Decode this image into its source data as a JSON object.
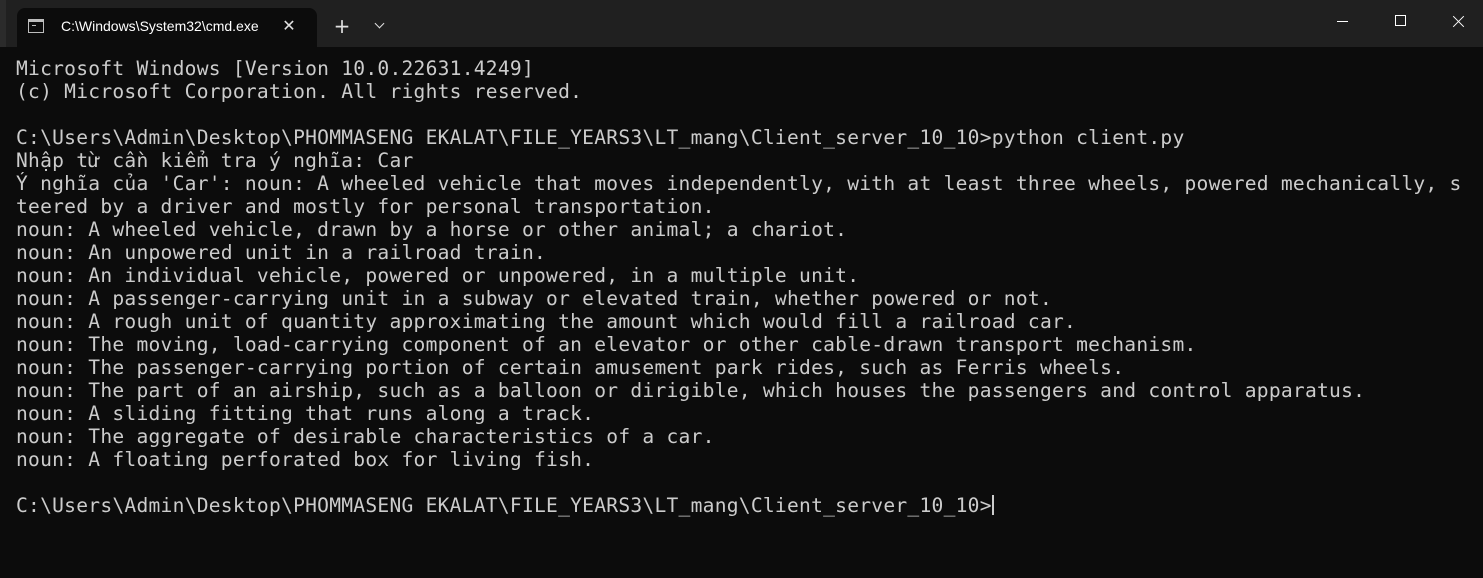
{
  "tab": {
    "title": "C:\\Windows\\System32\\cmd.exe",
    "icon": "cmd-icon",
    "close_icon": "close-icon"
  },
  "toolbar": {
    "new_tab_label": "+",
    "dropdown_icon": "chevron-down-icon"
  },
  "window_controls": [
    "minimize-icon",
    "maximize-icon",
    "close-icon"
  ],
  "console": {
    "lines": [
      "Microsoft Windows [Version 10.0.22631.4249]",
      "(c) Microsoft Corporation. All rights reserved.",
      "",
      "C:\\Users\\Admin\\Desktop\\PHOMMASENG EKALAT\\FILE_YEARS3\\LT_mang\\Client_server_10_10>python client.py",
      "Nhập từ cần kiểm tra ý nghĩa: Car",
      "Ý nghĩa của 'Car': noun: A wheeled vehicle that moves independently, with at least three wheels, powered mechanically, s",
      "teered by a driver and mostly for personal transportation.",
      "noun: A wheeled vehicle, drawn by a horse or other animal; a chariot.",
      "noun: An unpowered unit in a railroad train.",
      "noun: An individual vehicle, powered or unpowered, in a multiple unit.",
      "noun: A passenger-carrying unit in a subway or elevated train, whether powered or not.",
      "noun: A rough unit of quantity approximating the amount which would fill a railroad car.",
      "noun: The moving, load-carrying component of an elevator or other cable-drawn transport mechanism.",
      "noun: The passenger-carrying portion of certain amusement park rides, such as Ferris wheels.",
      "noun: The part of an airship, such as a balloon or dirigible, which houses the passengers and control apparatus.",
      "noun: A sliding fitting that runs along a track.",
      "noun: The aggregate of desirable characteristics of a car.",
      "noun: A floating perforated box for living fish.",
      ""
    ],
    "prompt": "C:\\Users\\Admin\\Desktop\\PHOMMASENG EKALAT\\FILE_YEARS3\\LT_mang\\Client_server_10_10>"
  },
  "colors": {
    "titlebar_bg": "#202020",
    "console_bg": "#0c0c0c",
    "console_text": "#cccccc"
  }
}
